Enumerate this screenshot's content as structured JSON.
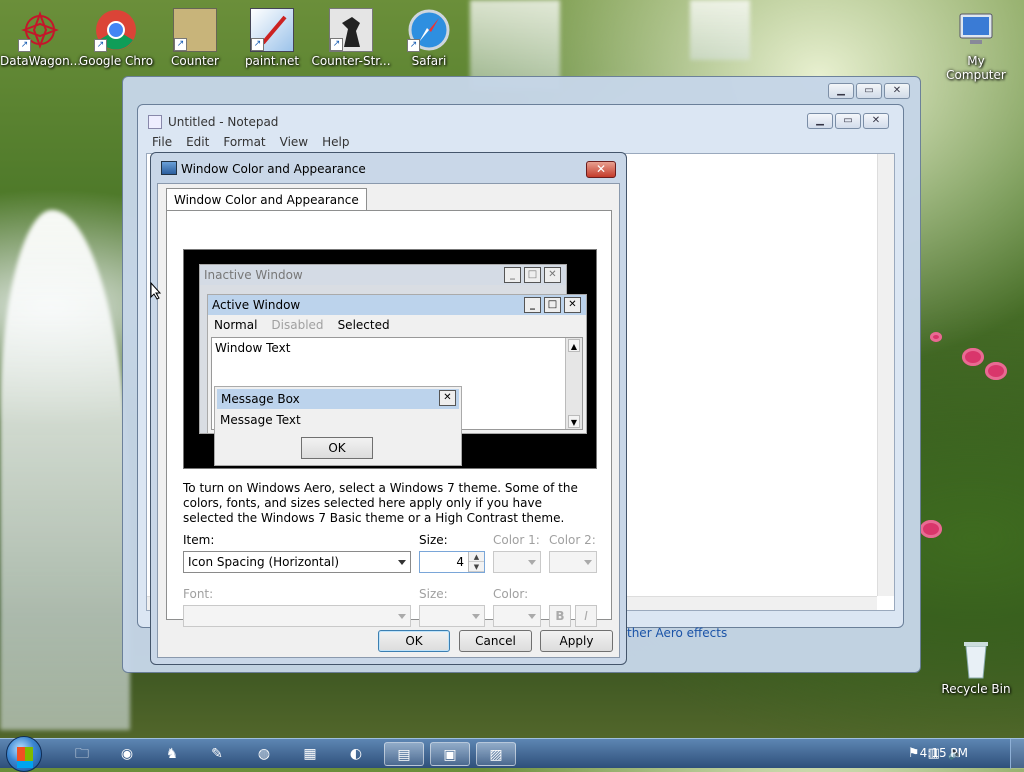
{
  "desktop": {
    "icons": [
      {
        "label": "DataWagon...",
        "icon": "datawagon-icon"
      },
      {
        "label": "Google Chro",
        "icon": "chrome-icon"
      },
      {
        "label": "Counter",
        "icon": "counter-icon"
      },
      {
        "label": "paint.net",
        "icon": "paintnet-icon"
      },
      {
        "label": "Counter-Str...",
        "icon": "counter-strike-icon"
      },
      {
        "label": "Safari",
        "icon": "safari-icon"
      },
      {
        "label": "My Computer",
        "icon": "my-computer-icon"
      },
      {
        "label": "Recycle Bin",
        "icon": "recycle-bin-icon"
      }
    ]
  },
  "notepad": {
    "title": "Untitled - Notepad",
    "menu": [
      "File",
      "Edit",
      "Format",
      "View",
      "Help"
    ],
    "aero_link": "ther Aero effects"
  },
  "dialog": {
    "title": "Window Color and Appearance",
    "tab": "Window Color and Appearance",
    "preview": {
      "inactive_title": "Inactive Window",
      "active_title": "Active Window",
      "menu_normal": "Normal",
      "menu_disabled": "Disabled",
      "menu_selected": "Selected",
      "window_text": "Window Text",
      "msgbox_title": "Message Box",
      "msgbox_text": "Message Text",
      "msgbox_ok": "OK"
    },
    "note": "To turn on Windows Aero, select a Windows 7 theme.  Some of the colors, fonts, and sizes selected here apply only if you have selected the Windows 7 Basic theme or a High Contrast theme.",
    "item_label": "Item:",
    "item_value": "Icon Spacing (Horizontal)",
    "size_label": "Size:",
    "size_value": "4",
    "color1_label": "Color 1:",
    "color2_label": "Color 2:",
    "font_label": "Font:",
    "font_size_label": "Size:",
    "font_color_label": "Color:",
    "bold_label": "B",
    "italic_label": "I",
    "ok": "OK",
    "cancel": "Cancel",
    "apply": "Apply"
  },
  "taskbar": {
    "clock": "4:15 PM"
  }
}
